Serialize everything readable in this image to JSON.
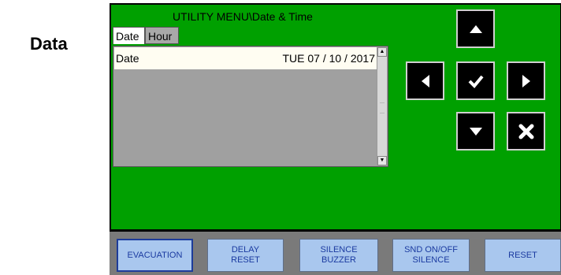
{
  "side_label": "Data",
  "window": {
    "title": "UTILITY MENU\\Date & Time",
    "tabs": [
      {
        "label": "Date",
        "selected": true
      },
      {
        "label": "Hour",
        "selected": false
      }
    ]
  },
  "list": {
    "rows": [
      {
        "label": "Date",
        "value": "TUE 07 / 10 / 2017"
      }
    ]
  },
  "navigation": {
    "up_icon": "arrow-up-icon",
    "down_icon": "arrow-down-icon",
    "left_icon": "arrow-left-icon",
    "right_icon": "arrow-right-icon",
    "confirm_icon": "check-icon",
    "cancel_icon": "cross-icon"
  },
  "function_buttons": [
    {
      "label": "EVACUATION",
      "active": true
    },
    {
      "label": "DELAY\nRESET",
      "active": false
    },
    {
      "label": "SILENCE\nBUZZER",
      "active": false
    },
    {
      "label": "SND ON/OFF\nSILENCE",
      "active": false
    },
    {
      "label": "RESET",
      "active": false
    }
  ],
  "colors": {
    "panel_green": "#00a000",
    "button_blue": "#a9c7ee",
    "button_text": "#1a3aa0",
    "bottom_bar": "#7a7a7a"
  }
}
